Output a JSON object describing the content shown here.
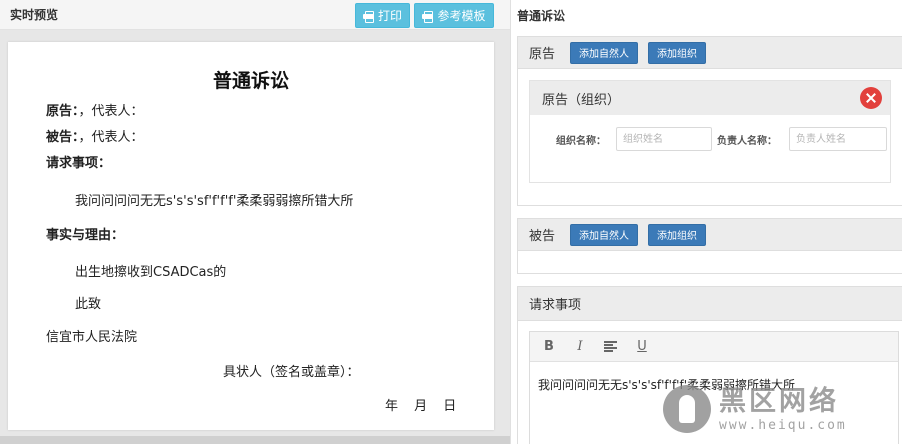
{
  "preview": {
    "title": "实时预览",
    "print_label": "打印",
    "template_label": "参考模板"
  },
  "document": {
    "title": "普通诉讼",
    "plaintiff_label": "原告：",
    "plaintiff_rest": "，代表人：",
    "defendant_label": "被告：",
    "defendant_rest": "，代表人：",
    "claims_label": "请求事项：",
    "claims_text": "我问问问问无无s's's'sf'f'f'f'柔柔弱弱擦所错大所",
    "facts_label": "事实与理由：",
    "facts_text": "出生地擦收到CSADCas的",
    "closing": "此致",
    "court": "信宜市人民法院",
    "signer": "具状人（签名或盖章）：",
    "date_line": "年 月 日"
  },
  "form": {
    "title": "普通诉讼",
    "plaintiff": {
      "label": "原告",
      "add_person_label": "添加自然人",
      "add_org_label": "添加组织",
      "org_card": {
        "title": "原告（组织）",
        "org_name_label": "组织名称：",
        "org_name_placeholder": "组织姓名",
        "leader_name_label": "负责人名称：",
        "leader_name_placeholder": "负责人姓名"
      }
    },
    "defendant": {
      "label": "被告",
      "add_person_label": "添加自然人",
      "add_org_label": "添加组织"
    },
    "claims": {
      "label": "请求事项",
      "toolbar": {
        "bold": "B",
        "italic": "I",
        "underline": "U"
      },
      "text": "我问问问问无无s's's'sf'f'f'f'柔柔弱弱擦所错大所"
    }
  },
  "watermark": {
    "title": "黑区网络",
    "url": "www.heiqu.com"
  },
  "colors": {
    "cyan_button": "#5bc0de",
    "blue_button": "#3b7ab8",
    "danger": "#e2403c",
    "section_head": "#ececec"
  },
  "icons": {
    "print": "printer-icon",
    "template": "printer-icon",
    "remove": "close-icon",
    "align": "align-left-icon"
  }
}
